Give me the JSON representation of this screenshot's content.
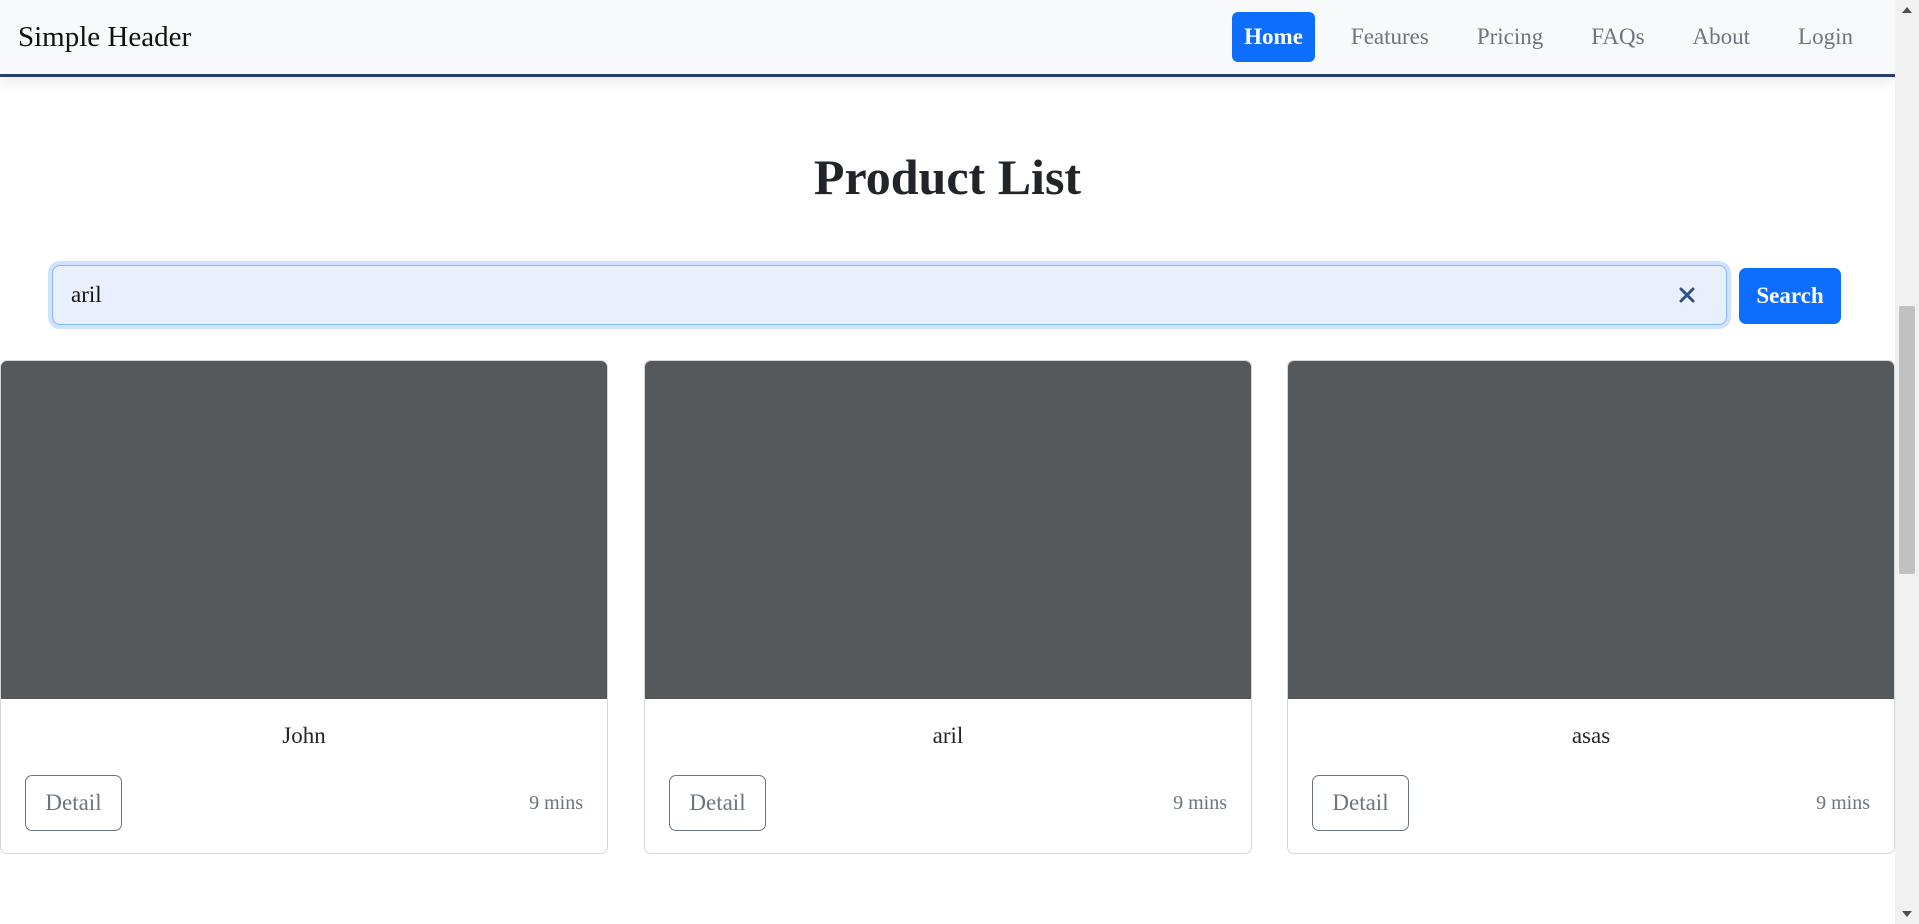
{
  "header": {
    "brand": "Simple Header",
    "nav": [
      "Home",
      "Features",
      "Pricing",
      "FAQs",
      "About",
      "Login"
    ],
    "active": "Home"
  },
  "main": {
    "title": "Product List",
    "search": {
      "value": "aril",
      "button_label": "Search"
    },
    "cards": [
      {
        "name": "John",
        "button_label": "Detail",
        "time": "9 mins"
      },
      {
        "name": "aril",
        "button_label": "Detail",
        "time": "9 mins"
      },
      {
        "name": "asas",
        "button_label": "Detail",
        "time": "9 mins"
      }
    ]
  },
  "colors": {
    "accent": "#0d6efd",
    "header_bg": "#f8f9fa",
    "header_border": "#2a3f66",
    "card_image": "#55595c",
    "muted": "#6c757d"
  },
  "icons": {
    "clear": "close-icon",
    "scroll_up": "scroll-up-arrow-icon",
    "scroll_down": "scroll-down-arrow-icon"
  }
}
